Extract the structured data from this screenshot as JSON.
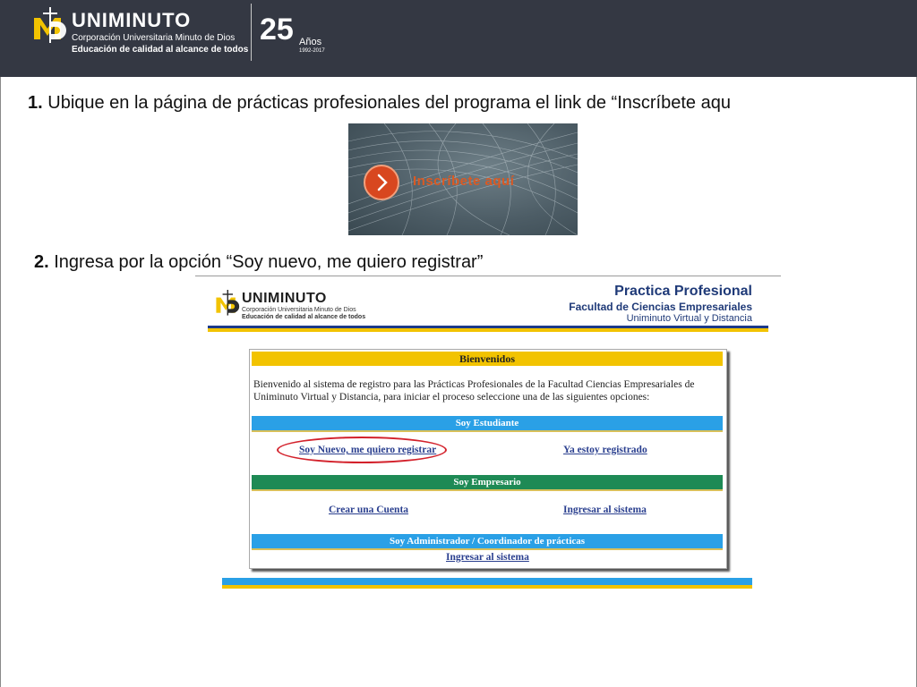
{
  "header": {
    "brand_name": "UNIMINUTO",
    "brand_sub1": "Corporación Universitaria Minuto de Dios",
    "brand_sub2": "Educación de calidad al alcance de todos",
    "anniversary_number": "25",
    "anniversary_word": "Años",
    "anniversary_years": "1992-2017",
    "bg_color": "#343843"
  },
  "step1": {
    "number": "1.",
    "text": "Ubique en la página de prácticas profesionales del programa el link de “Inscríbete aqu"
  },
  "banner": {
    "label": "Inscríbete aquí",
    "button_color": "#d8471f"
  },
  "step2": {
    "number": "2.",
    "text": "Ingresa por la opción “Soy nuevo, me quiero registrar”"
  },
  "screenshot": {
    "logo_name": "UNIMINUTO",
    "logo_sub1": "Corporación Universitaria Minuto de Dios",
    "logo_sub2": "Educación de calidad al alcance de todos",
    "title": "Practica Profesional",
    "subtitle1": "Facultad de Ciencias Empresariales",
    "subtitle2": "Uniminuto Virtual y Distancia",
    "welcome_header": "Bienvenidos",
    "welcome_text": "Bienvenido al sistema de registro para las Prácticas Profesionales de la Facultad Ciencias Empresariales de Uniminuto Virtual y Distancia, para iniciar el proceso seleccione una de las siguientes opciones:",
    "student_header": "Soy Estudiante",
    "student_new": "Soy Nuevo, me quiero registrar",
    "student_registered": "Ya estoy registrado",
    "employer_header": "Soy Empresario",
    "employer_create": "Crear una Cuenta",
    "employer_login": "Ingresar al sistema",
    "admin_header": "Soy Administrador / Coordinador de prácticas",
    "admin_login": "Ingresar al sistema",
    "colors": {
      "yellow": "#f2c300",
      "blue": "#2aa0e6",
      "green": "#1e8a55",
      "navy": "#1f3a78",
      "highlight": "#d3212b"
    }
  }
}
